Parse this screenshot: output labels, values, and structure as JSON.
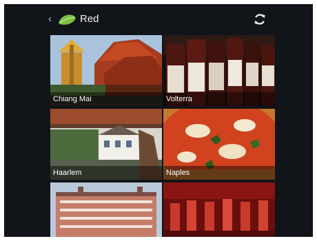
{
  "action_bar": {
    "title": "Red",
    "up_icon": "chevron-left-icon",
    "app_icon": "leaf-icon",
    "refresh_icon": "refresh-icon"
  },
  "photos": [
    {
      "caption": "Chiang Mai"
    },
    {
      "caption": "Volterra"
    },
    {
      "caption": "Haarlem"
    },
    {
      "caption": "Naples"
    },
    {
      "caption": ""
    },
    {
      "caption": ""
    }
  ],
  "colors": {
    "background": "#111418",
    "title_text": "#f0f2f4",
    "app_icon_green": "#79c043"
  }
}
